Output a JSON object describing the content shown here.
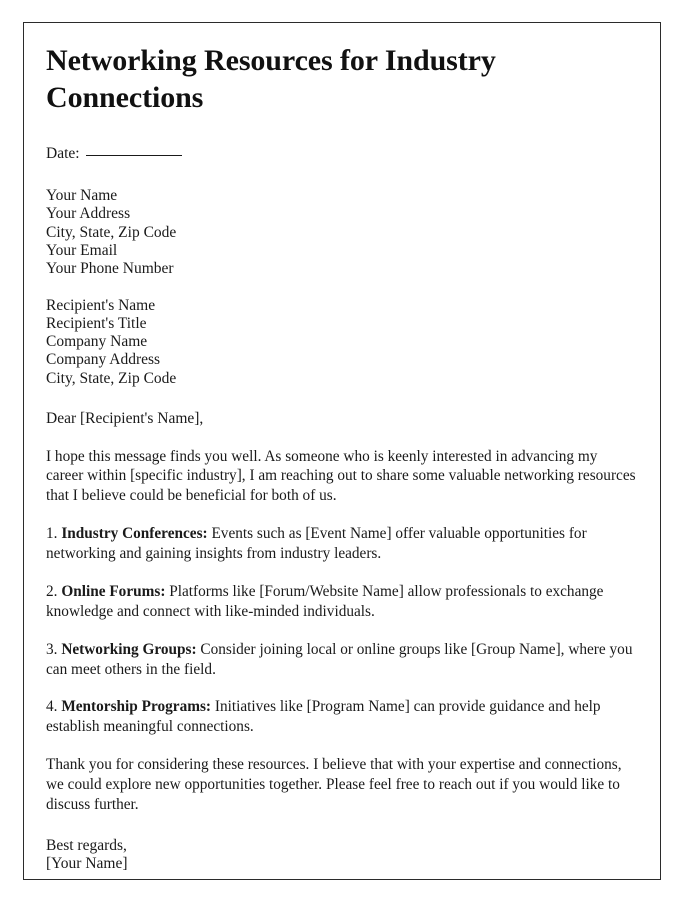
{
  "document": {
    "title": "Networking Resources for Industry Connections",
    "date_label": "Date:",
    "sender": {
      "lines": [
        "Your Name",
        "Your Address",
        "City, State, Zip Code",
        "Your Email",
        "Your Phone Number"
      ]
    },
    "recipient": {
      "lines": [
        "Recipient's Name",
        "Recipient's Title",
        "Company Name",
        "Company Address",
        "City, State, Zip Code"
      ]
    },
    "salutation": "Dear [Recipient's Name],",
    "opening_paragraph": "I hope this message finds you well. As someone who is keenly interested in advancing my career within [specific industry], I am reaching out to share some valuable networking resources that I believe could be beneficial for both of us.",
    "items": [
      {
        "number": "1.",
        "label": "Industry Conferences:",
        "text": "Events such as [Event Name] offer valuable opportunities for networking and gaining insights from industry leaders."
      },
      {
        "number": "2.",
        "label": "Online Forums:",
        "text": "Platforms like [Forum/Website Name] allow professionals to exchange knowledge and connect with like-minded individuals."
      },
      {
        "number": "3.",
        "label": "Networking Groups:",
        "text": "Consider joining local or online groups like [Group Name], where you can meet others in the field."
      },
      {
        "number": "4.",
        "label": "Mentorship Programs:",
        "text": "Initiatives like [Program Name] can provide guidance and help establish meaningful connections."
      }
    ],
    "closing_paragraph": "Thank you for considering these resources. I believe that with your expertise and connections, we could explore new opportunities together. Please feel free to reach out if you would like to discuss further.",
    "signoff": "Best regards,",
    "signature_name": "[Your Name]"
  }
}
